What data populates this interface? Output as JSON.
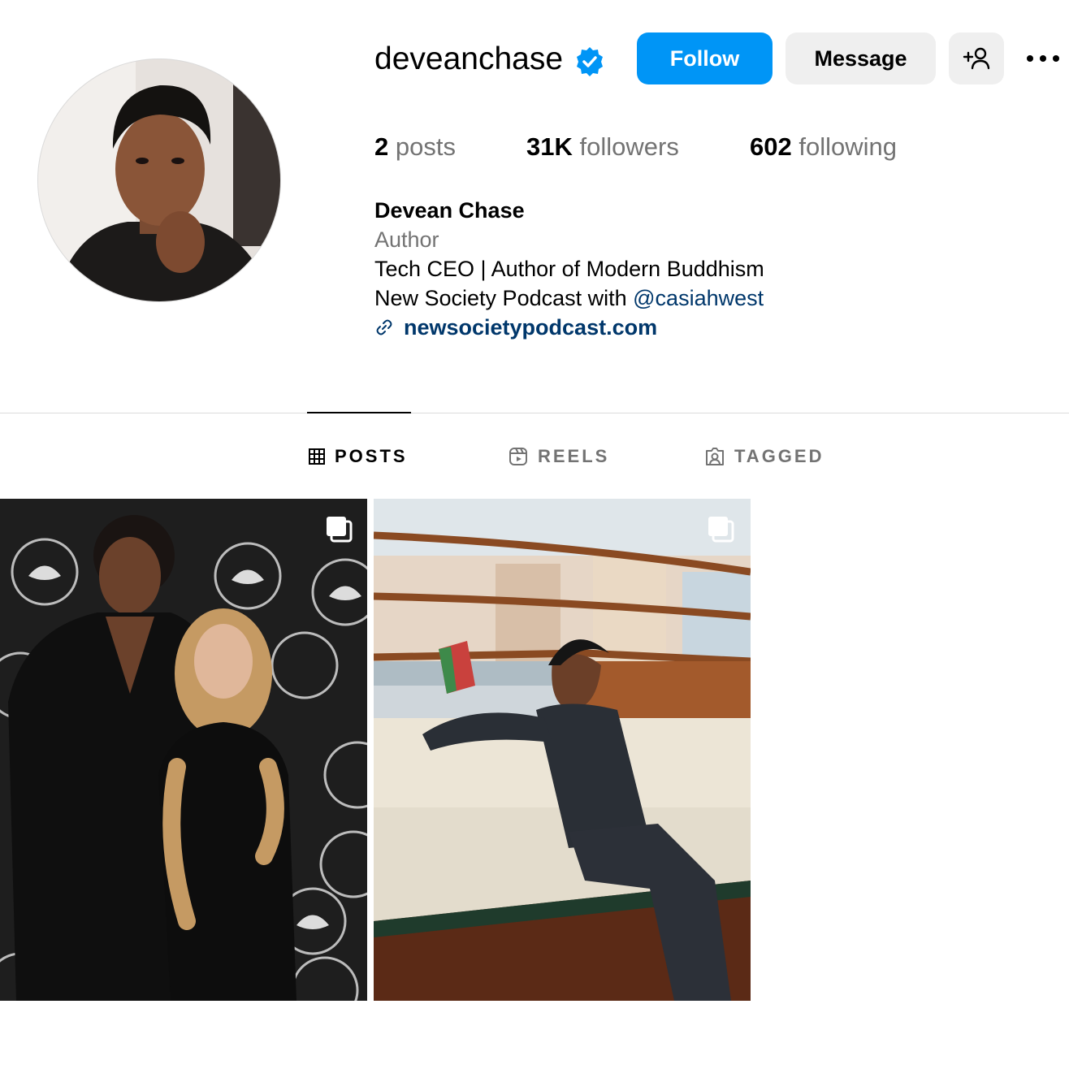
{
  "profile": {
    "username": "deveanchase",
    "verified": true,
    "follow_label": "Follow",
    "message_label": "Message",
    "stats": {
      "posts_count": "2",
      "posts_label": "posts",
      "followers_count": "31K",
      "followers_label": "followers",
      "following_count": "602",
      "following_label": "following"
    },
    "bio": {
      "name": "Devean Chase",
      "category": "Author",
      "line1": "Tech CEO | Author of Modern Buddhism",
      "line2_prefix": "New Society Podcast with ",
      "line2_mention": "@casiahwest",
      "link": "newsocietypodcast.com"
    }
  },
  "tabs": [
    {
      "label": "POSTS",
      "icon": "grid-icon",
      "active": true
    },
    {
      "label": "REELS",
      "icon": "reels-icon",
      "active": false
    },
    {
      "label": "TAGGED",
      "icon": "tagged-icon",
      "active": false
    }
  ],
  "posts": [
    {
      "type": "carousel",
      "icon": "multiple-images-icon"
    },
    {
      "type": "carousel",
      "icon": "multiple-images-icon"
    }
  ],
  "colors": {
    "accent": "#0095f6",
    "verified": "#0095f6",
    "link": "#00376b",
    "secondary_text": "#737373",
    "button_gray": "#efefef"
  }
}
